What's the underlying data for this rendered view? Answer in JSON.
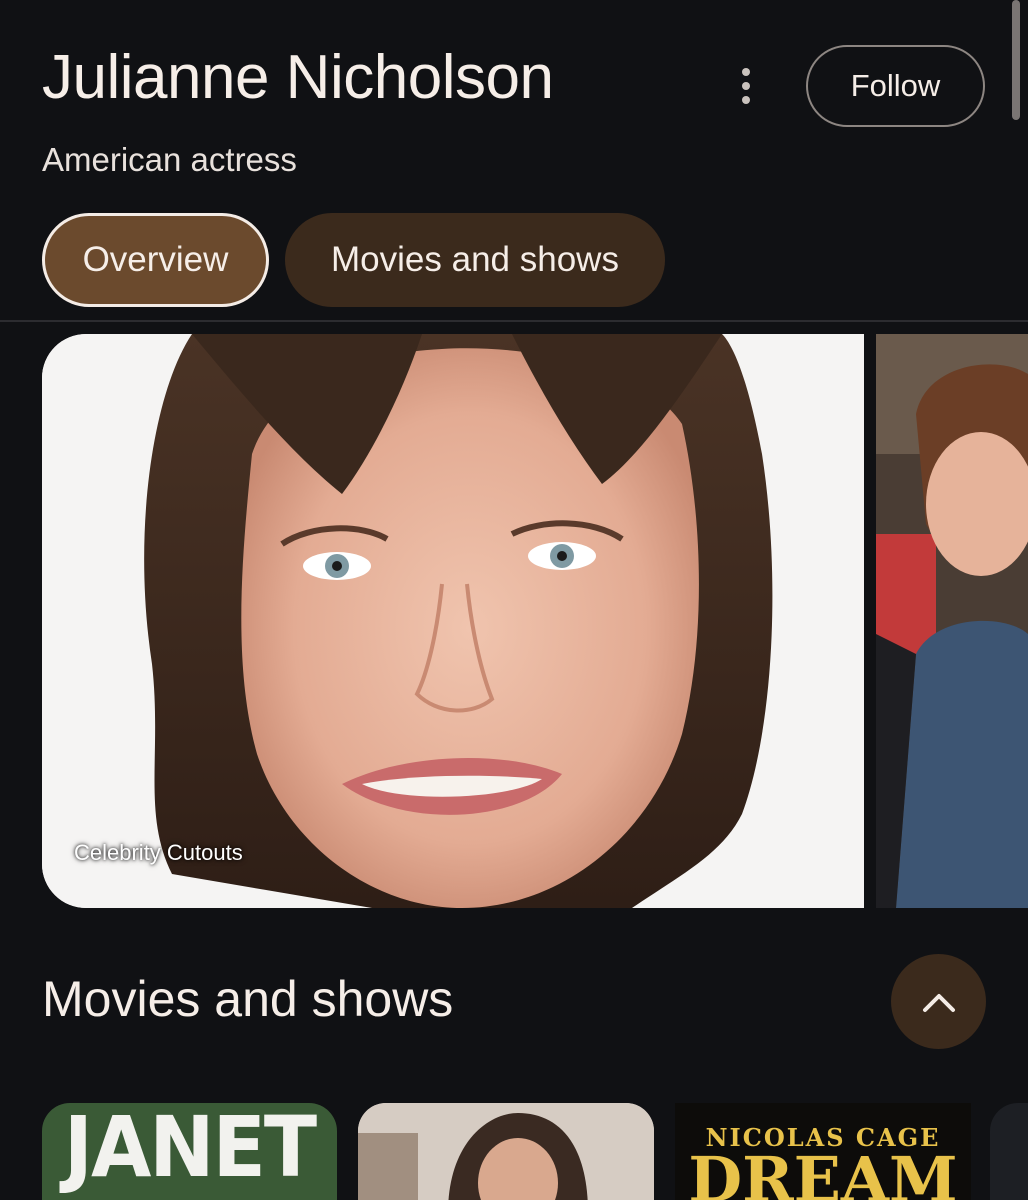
{
  "header": {
    "title": "Julianne Nicholson",
    "subtitle": "American actress",
    "follow_label": "Follow"
  },
  "tabs": [
    {
      "label": "Overview",
      "selected": true
    },
    {
      "label": "Movies and shows",
      "selected": false
    }
  ],
  "images": {
    "main_caption": "Celebrity Cutouts"
  },
  "section": {
    "title": "Movies and shows"
  },
  "posters": [
    {
      "text": "JANET"
    },
    {
      "text": ""
    },
    {
      "top_text": "NICOLAS CAGE",
      "main_text": "DREAM"
    },
    {
      "text": ""
    }
  ],
  "colors": {
    "background": "#101114",
    "chip_selected": "#6b4a2d",
    "chip": "#3b2a1c",
    "text": "#f6eee8"
  },
  "icons": {
    "more": "more-vert-icon",
    "collapse": "chevron-up-icon"
  }
}
